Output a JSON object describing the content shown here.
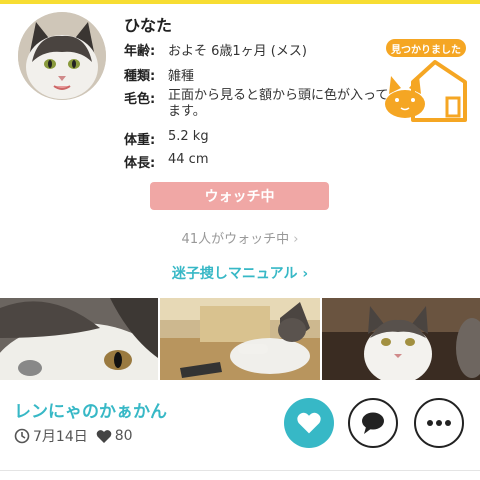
{
  "pet": {
    "name": "ひなた",
    "fields": [
      {
        "label": "年齢:",
        "value": "およそ 6歳1ヶ月 (メス)"
      },
      {
        "label": "種類:",
        "value": "雑種"
      },
      {
        "label": "毛色:",
        "value": "正面から見ると額から頭に色が入ってます。"
      },
      {
        "label": "体重:",
        "value": "5.2 kg"
      },
      {
        "label": "体長:",
        "value": "44 cm"
      }
    ]
  },
  "badge": {
    "label": "見つかりました",
    "icon": "cat-in-house-icon",
    "color": "#f5a623"
  },
  "actions": {
    "watch_label": "ウォッチ中",
    "watch_count": "41人がウォッチ中",
    "manual_link": "迷子捜しマニュアル"
  },
  "post": {
    "poster": "レンにゃのかぁかん",
    "date": "7月14日",
    "likes": "80"
  },
  "colors": {
    "accent": "#37b8c6",
    "watch": "#f0a7a5",
    "top_bar": "#f7dd32"
  }
}
